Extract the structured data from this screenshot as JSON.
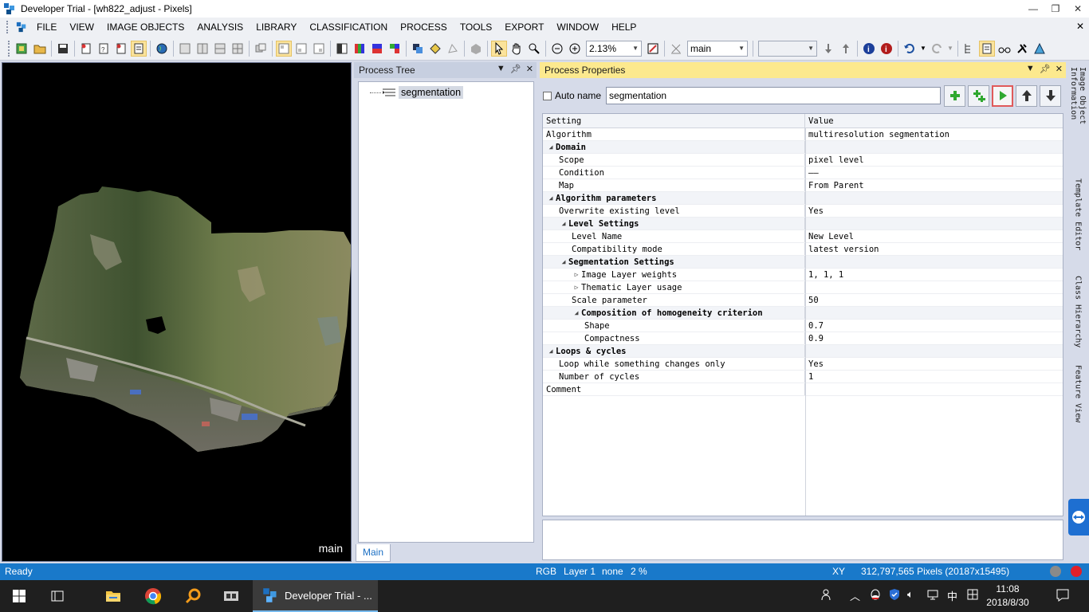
{
  "window": {
    "title": "Developer Trial - [wh822_adjust - Pixels]",
    "controls": {
      "minimize": "—",
      "restore": "❐",
      "close": "✕"
    }
  },
  "menu": {
    "items": [
      "FILE",
      "VIEW",
      "IMAGE OBJECTS",
      "ANALYSIS",
      "LIBRARY",
      "CLASSIFICATION",
      "PROCESS",
      "TOOLS",
      "EXPORT",
      "WINDOW",
      "HELP"
    ],
    "close_glyph": "✕"
  },
  "toolbar": {
    "zoom_value": "2.13%",
    "map_value": "main",
    "empty_combo": ""
  },
  "image_view": {
    "map_label": "main"
  },
  "process_tree": {
    "title": "Process Tree",
    "node": "segmentation",
    "tab": "Main"
  },
  "process_properties": {
    "title": "Process Properties",
    "auto_name_label": "Auto name",
    "name_value": "segmentation",
    "columns": {
      "setting": "Setting",
      "value": "Value"
    },
    "rows": [
      {
        "level": 0,
        "toggle": "",
        "group": false,
        "setting": "Algorithm",
        "value": "multiresolution segmentation"
      },
      {
        "level": 0,
        "toggle": "◢",
        "group": true,
        "setting": "Domain",
        "value": ""
      },
      {
        "level": 1,
        "toggle": "",
        "group": false,
        "setting": "Scope",
        "value": "pixel level"
      },
      {
        "level": 1,
        "toggle": "",
        "group": false,
        "setting": "Condition",
        "value": "——"
      },
      {
        "level": 1,
        "toggle": "",
        "group": false,
        "setting": "Map",
        "value": "From Parent"
      },
      {
        "level": 0,
        "toggle": "◢",
        "group": true,
        "setting": "Algorithm parameters",
        "value": ""
      },
      {
        "level": 1,
        "toggle": "",
        "group": false,
        "setting": "Overwrite existing level",
        "value": "Yes"
      },
      {
        "level": 1,
        "toggle": "◢",
        "group": true,
        "setting": "Level Settings",
        "value": ""
      },
      {
        "level": 2,
        "toggle": "",
        "group": false,
        "setting": "Level Name",
        "value": "New Level"
      },
      {
        "level": 2,
        "toggle": "",
        "group": false,
        "setting": "Compatibility mode",
        "value": "latest version"
      },
      {
        "level": 1,
        "toggle": "◢",
        "group": true,
        "setting": "Segmentation Settings",
        "value": ""
      },
      {
        "level": 2,
        "toggle": "▷",
        "group": false,
        "setting": "Image Layer weights",
        "value": "1, 1, 1"
      },
      {
        "level": 2,
        "toggle": "▷",
        "group": false,
        "setting": "Thematic Layer usage",
        "value": ""
      },
      {
        "level": 2,
        "toggle": "",
        "group": false,
        "setting": "Scale parameter",
        "value": "50"
      },
      {
        "level": 2,
        "toggle": "◢",
        "group": true,
        "setting": "Composition of homogeneity criterion",
        "value": ""
      },
      {
        "level": 3,
        "toggle": "",
        "group": false,
        "setting": "Shape",
        "value": "0.7"
      },
      {
        "level": 3,
        "toggle": "",
        "group": false,
        "setting": "Compactness",
        "value": "0.9"
      },
      {
        "level": 0,
        "toggle": "◢",
        "group": true,
        "setting": "Loops & cycles",
        "value": ""
      },
      {
        "level": 1,
        "toggle": "",
        "group": false,
        "setting": "Loop while something changes only",
        "value": "Yes"
      },
      {
        "level": 1,
        "toggle": "",
        "group": false,
        "setting": "Number of cycles",
        "value": "1"
      },
      {
        "level": 0,
        "toggle": "",
        "group": false,
        "setting": "Comment",
        "value": ""
      }
    ]
  },
  "dock_tabs": [
    "Image Object Information",
    "Template Editor",
    "Class Hierarchy",
    "Feature View"
  ],
  "status": {
    "ready": "Ready",
    "mode": "RGB",
    "layer": "Layer 1",
    "none": "none",
    "percent": "2 %",
    "coord": "XY",
    "pixels": "312,797,565 Pixels  (20187x15495)"
  },
  "taskbar": {
    "active_app": "Developer Trial - ...",
    "time": "11:08",
    "date": "2018/8/30",
    "ime": "中"
  },
  "colors": {
    "accent_blue": "#1979ca",
    "panel_yellow": "#fce98e",
    "run_green": "#2fa82f"
  }
}
